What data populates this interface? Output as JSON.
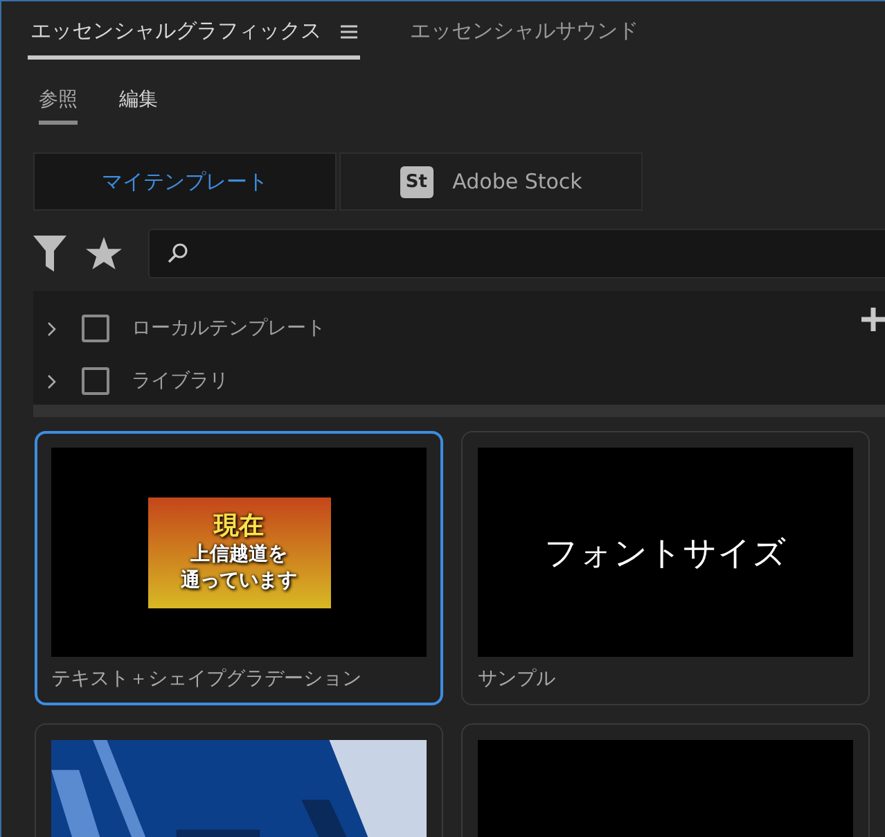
{
  "panel_tabs": [
    {
      "label": "エッセンシャルグラフィックス",
      "selected": true,
      "menu": true
    },
    {
      "label": "エッセンシャルサウンド",
      "selected": false,
      "menu": false
    }
  ],
  "sub_tabs": [
    {
      "label": "参照",
      "selected": true
    },
    {
      "label": "編集",
      "selected": false
    }
  ],
  "sources": [
    {
      "label": "マイテンプレート",
      "selected": true,
      "kind": "plain"
    },
    {
      "label": "Adobe Stock",
      "selected": false,
      "kind": "stock",
      "badge": "St"
    }
  ],
  "folders": [
    {
      "label": "ローカルテンプレート",
      "checked": false
    },
    {
      "label": "ライブラリ",
      "checked": false
    }
  ],
  "templates": [
    {
      "name": "テキスト＋シェイプグラデーション",
      "selected": true,
      "kind": "gradient-caption",
      "preview_lines": [
        "現在",
        "上信越道を",
        "通っています"
      ]
    },
    {
      "name": "サンプル",
      "selected": false,
      "kind": "plain-text",
      "preview_lines": [
        "フォントサイズ"
      ]
    },
    {
      "selected": false,
      "kind": "blue-graphic"
    },
    {
      "selected": false,
      "kind": "blank"
    }
  ]
}
